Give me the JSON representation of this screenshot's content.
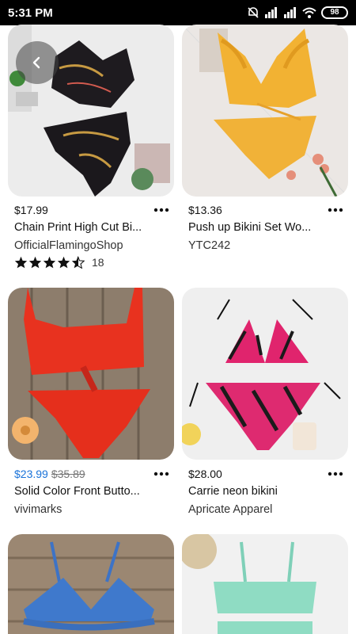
{
  "status_bar": {
    "time": "5:31 PM",
    "battery": "98",
    "icons": [
      "mute-icon",
      "signal-icon",
      "signal-icon",
      "wifi-icon",
      "battery-icon"
    ]
  },
  "back_button": {
    "icon": "chevron-left-icon"
  },
  "products": [
    {
      "price": "$17.99",
      "title": "Chain Print High Cut Bi...",
      "seller": "OfficialFlamingoShop",
      "rating": 4.5,
      "reviews": "18"
    },
    {
      "price": "$13.36",
      "title": "Push up Bikini Set Wo...",
      "seller": "YTC242"
    },
    {
      "price": "$23.99",
      "old_price": "$35.89",
      "title": "Solid Color Front Butto...",
      "seller": "vivimarks"
    },
    {
      "price": "$28.00",
      "title": "Carrie neon bikini",
      "seller": "Apricate Apparel"
    },
    {
      "image": "blue bikini"
    },
    {
      "image": "mint bikini"
    }
  ],
  "colors": {
    "sale_price": "#1a73d9",
    "strike_price": "#767676"
  }
}
